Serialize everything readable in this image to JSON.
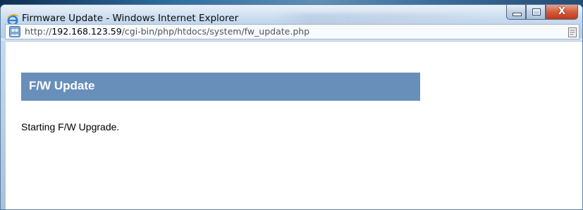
{
  "window": {
    "title": "Firmware Update - Windows Internet Explorer",
    "close_glyph": "X",
    "icons": {
      "app": "ie-icon",
      "minimize": "minimize-icon",
      "maximize": "maximize-icon",
      "close": "close-icon"
    }
  },
  "address_bar": {
    "url_prefix": "http://",
    "url_host": "192.168.123.59",
    "url_path": "/cgi-bin/php/htdocs/system/fw_update.php",
    "site_icon": "page-favicon-icon",
    "page_icon": "compatibility-view-icon"
  },
  "page": {
    "header_title": "F/W Update",
    "status_text": "Starting F/W Upgrade.",
    "header_color": "#688fba"
  }
}
